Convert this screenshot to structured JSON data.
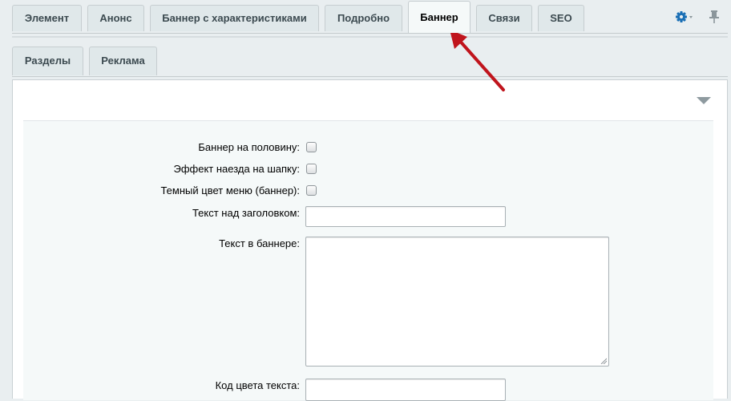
{
  "tabs": [
    {
      "label": "Элемент"
    },
    {
      "label": "Анонс"
    },
    {
      "label": "Баннер с характеристиками"
    },
    {
      "label": "Подробно"
    },
    {
      "label": "Баннер",
      "active": true
    },
    {
      "label": "Связи"
    },
    {
      "label": "SEO"
    }
  ],
  "toolbar": {
    "settings_icon": "gear-icon",
    "pin_icon": "pin-icon"
  },
  "subtabs": [
    {
      "label": "Разделы"
    },
    {
      "label": "Реклама"
    }
  ],
  "form": {
    "half_banner_label": "Баннер на половину:",
    "half_banner_checked": false,
    "header_effect_label": "Эффект наезда на шапку:",
    "header_effect_checked": false,
    "dark_menu_label": "Темный цвет меню (баннер):",
    "dark_menu_checked": false,
    "text_above_label": "Текст над заголовком:",
    "text_above_value": "",
    "banner_text_label": "Текст в баннере:",
    "banner_text_value": "",
    "text_color_label": "Код цвета текста:",
    "text_color_value": ""
  },
  "colors": {
    "annotation_arrow": "#c0141c",
    "gear": "#1a6fb5"
  }
}
